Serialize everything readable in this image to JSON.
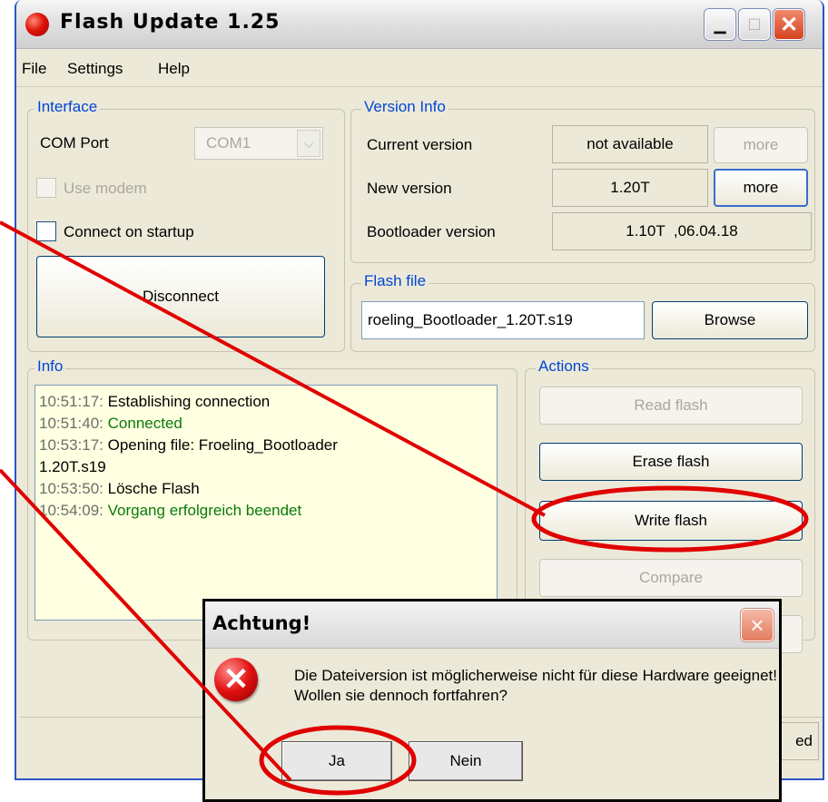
{
  "window": {
    "title": "Flash Update 1.25"
  },
  "menu": [
    "File",
    "Settings",
    "Help"
  ],
  "interface": {
    "label": "Interface",
    "com_port_label": "COM Port",
    "com_port_value": "COM1",
    "use_modem_label": "Use modem",
    "connect_on_startup_label": "Connect on startup",
    "disconnect_label": "Disconnect"
  },
  "version_info": {
    "label": "Version Info",
    "current_label": "Current version",
    "current_value": "not available",
    "more_disabled_label": "more",
    "new_label": "New version",
    "new_value": "1.20T",
    "more_label": "more",
    "bootloader_label": "Bootloader version",
    "bootloader_value": "1.10T  ,06.04.18"
  },
  "flash_file": {
    "label": "Flash file",
    "value": "roeling_Bootloader_1.20T.s19",
    "browse_label": "Browse"
  },
  "info": {
    "label": "Info",
    "log": [
      {
        "time": "10:51:17:",
        "text": " Establishing connection",
        "style": "normal"
      },
      {
        "time": "10:51:40:",
        "text": " Connected",
        "style": "green"
      },
      {
        "time": "10:53:17:",
        "text": " Opening file: Froeling_Bootloader",
        "style": "normal"
      },
      {
        "time": "",
        "text": "1.20T.s19",
        "style": "normal"
      },
      {
        "time": "10:53:50:",
        "text": " Lösche Flash",
        "style": "normal"
      },
      {
        "time": "10:54:09:",
        "text": " Vorgang erfolgreich beendet",
        "style": "green"
      }
    ]
  },
  "actions": {
    "label": "Actions",
    "read_flash": "Read flash",
    "erase_flash": "Erase flash",
    "write_flash": "Write flash",
    "compare": "Compare"
  },
  "status_partial": "ed",
  "dialog": {
    "title": "Achtung!",
    "close": "×",
    "icon": "error-icon",
    "message_line1": "Die Dateiversion ist möglicherweise nicht für diese Hardware geeignet!",
    "message_line2": "Wollen sie dennoch fortfahren?",
    "yes_label": "Ja",
    "no_label": "Nein"
  },
  "colors": {
    "annotation": "#e00000",
    "group_label": "#0046d5",
    "log_bg": "#ffffe1"
  }
}
